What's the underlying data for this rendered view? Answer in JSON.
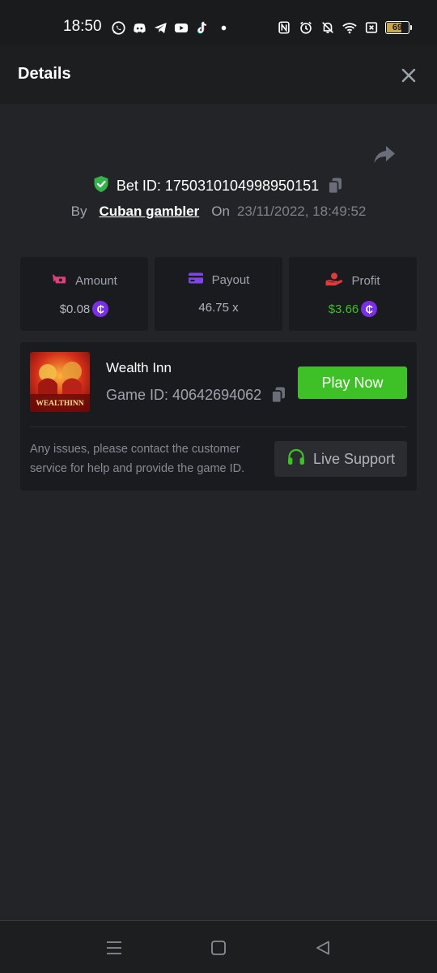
{
  "status_bar": {
    "time": "18:50",
    "battery": "69",
    "app_icons": [
      "whatsapp-icon",
      "discord-icon",
      "telegram-icon",
      "youtube-icon",
      "tiktok-icon",
      "dot-icon"
    ],
    "system_icons": [
      "nfc-icon",
      "alarm-icon",
      "bell-off-icon",
      "wifi-icon",
      "sim-off-icon",
      "battery-icon"
    ]
  },
  "header": {
    "title": "Details"
  },
  "bet": {
    "label": "Bet ID: 1750310104998950151",
    "by_label": "By",
    "username": "Cuban gambler",
    "on_label": "On",
    "date": "23/11/2022, 18:49:52"
  },
  "stats": {
    "amount": {
      "label": "Amount",
      "value": "$0.08"
    },
    "payout": {
      "label": "Payout",
      "value": "46.75 x"
    },
    "profit": {
      "label": "Profit",
      "value": "$3.66"
    }
  },
  "game": {
    "name": "Wealth Inn",
    "id_label": "Game ID: 40642694062",
    "thumb_text": "WEALTHINN",
    "play_label": "Play Now",
    "support_text": "Any issues, please contact the customer service for help and provide the game ID.",
    "support_button": "Live Support"
  },
  "colors": {
    "background": "#232427",
    "card": "#1a1b1e",
    "accent_green": "#3ec127",
    "coin_purple": "#7a2ee6",
    "shield_green": "#36b24a",
    "amount_icon": "#e0407a",
    "payout_icon": "#7f45e8",
    "profit_icon": "#e03a3a"
  },
  "coin_symbol": "₵"
}
